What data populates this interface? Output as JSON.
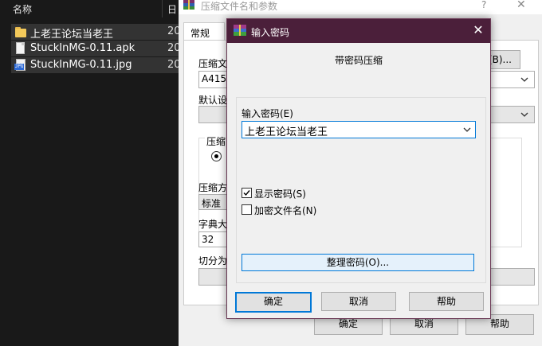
{
  "explorer": {
    "col_name": "名称",
    "col_date": "日",
    "files": [
      {
        "name": "上老王论坛当老王",
        "date": "20",
        "type": "folder"
      },
      {
        "name": "StuckInMG-0.11.apk",
        "date": "20",
        "type": "file"
      },
      {
        "name": "StuckInMG-0.11.jpg",
        "date": "20",
        "type": "jpg"
      }
    ]
  },
  "bg_dialog": {
    "title": "压缩文件名和参数",
    "help_icon": "?",
    "close_icon": "✕",
    "tab_general": "常规",
    "label_archive_name": "压缩文",
    "archive_name_value": "A4151",
    "browse_label": "(B)...",
    "label_default": "默认设",
    "label_format": "压缩",
    "label_method": "压缩方",
    "method_value": "标准",
    "label_dict": "字典大",
    "dict_value": "32",
    "label_split": "切分为",
    "ok_label": "确定",
    "cancel_label": "取消",
    "help_label": "帮助"
  },
  "pw_dialog": {
    "title": "输入密码",
    "close_icon": "✕",
    "heading": "带密码压缩",
    "password_label": "输入密码(E)",
    "password_value": "上老王论坛当老王",
    "show_password_label": "显示密码(S)",
    "show_password_checked": true,
    "encrypt_names_label": "加密文件名(N)",
    "encrypt_names_checked": false,
    "manage_label": "整理密码(O)...",
    "ok_label": "确定",
    "cancel_label": "取消",
    "help_label": "帮助"
  }
}
